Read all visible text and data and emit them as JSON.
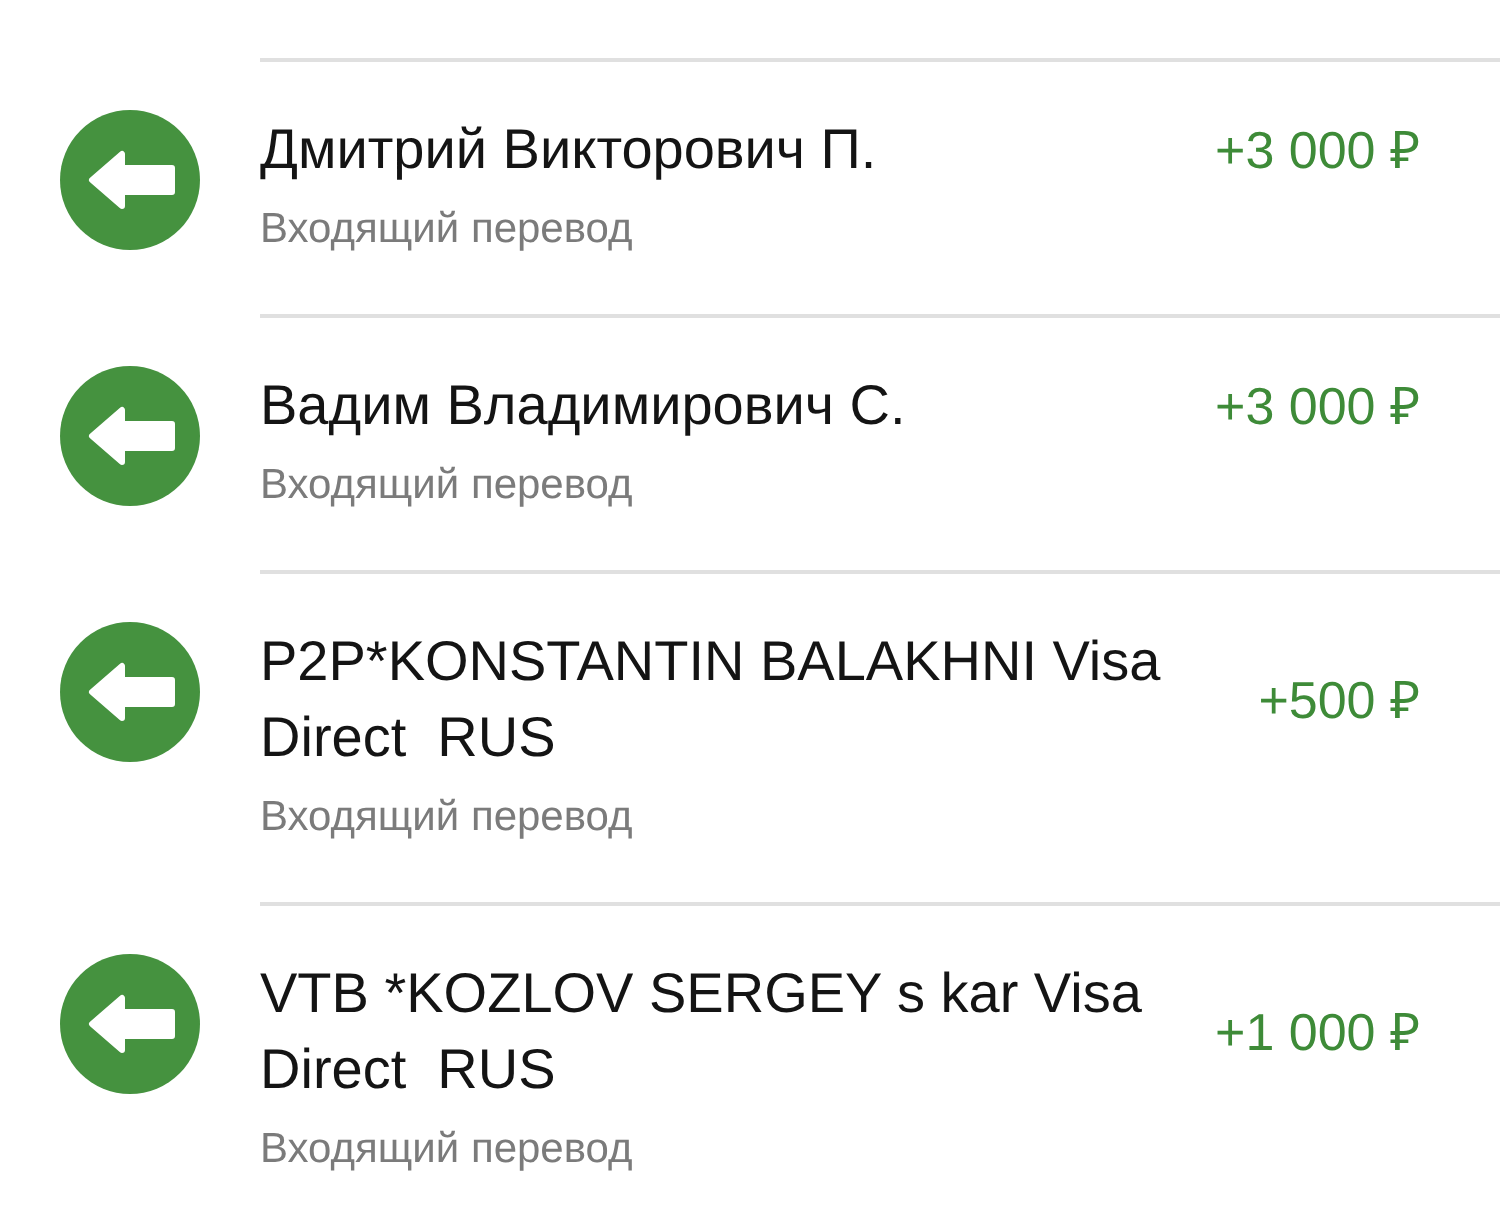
{
  "transactions": [
    {
      "title": "Дмитрий Викторович П.",
      "subtitle": "Входящий перевод",
      "amount": "+3 000 ₽"
    },
    {
      "title": "Вадим Владимирович С.",
      "subtitle": "Входящий перевод",
      "amount": "+3 000 ₽"
    },
    {
      "title": "P2P*KONSTANTIN BALAKHNI Visa Direct  RUS",
      "subtitle": "Входящий перевод",
      "amount": "+500 ₽"
    },
    {
      "title": "VTB *KOZLOV SERGEY s kar Visa Direct  RUS",
      "subtitle": "Входящий перевод",
      "amount": "+1 000 ₽"
    }
  ]
}
